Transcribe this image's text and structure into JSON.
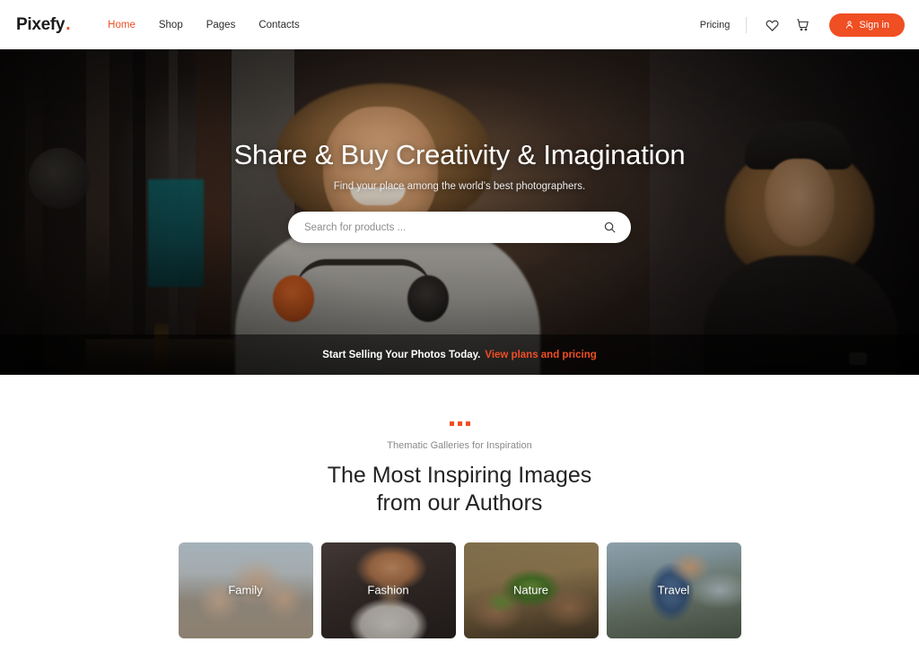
{
  "brand": {
    "name": "Pixefy",
    "dot": ".",
    "accent": "#f04e23"
  },
  "nav": {
    "links": [
      {
        "label": "Home",
        "active": true
      },
      {
        "label": "Shop",
        "active": false
      },
      {
        "label": "Pages",
        "active": false
      },
      {
        "label": "Contacts",
        "active": false
      }
    ],
    "pricing_label": "Pricing",
    "wishlist_icon": "heart-icon",
    "cart_icon": "cart-icon",
    "signin_label": "Sign in",
    "signin_icon": "user-icon"
  },
  "hero": {
    "title": "Share & Buy Creativity & Imagination",
    "subtitle": "Find your place among the world’s best photographers.",
    "search": {
      "placeholder": "Search for products ...",
      "value": "",
      "icon": "search-icon"
    },
    "banner": {
      "text": "Start Selling Your Photos Today.",
      "link": "View plans and pricing"
    }
  },
  "gallery": {
    "eyebrow": "Thematic Galleries for Inspiration",
    "title_line1": "The Most Inspiring Images",
    "title_line2": "from our Authors",
    "cards": [
      {
        "label": "Family"
      },
      {
        "label": "Fashion"
      },
      {
        "label": "Nature"
      },
      {
        "label": "Travel"
      }
    ]
  }
}
